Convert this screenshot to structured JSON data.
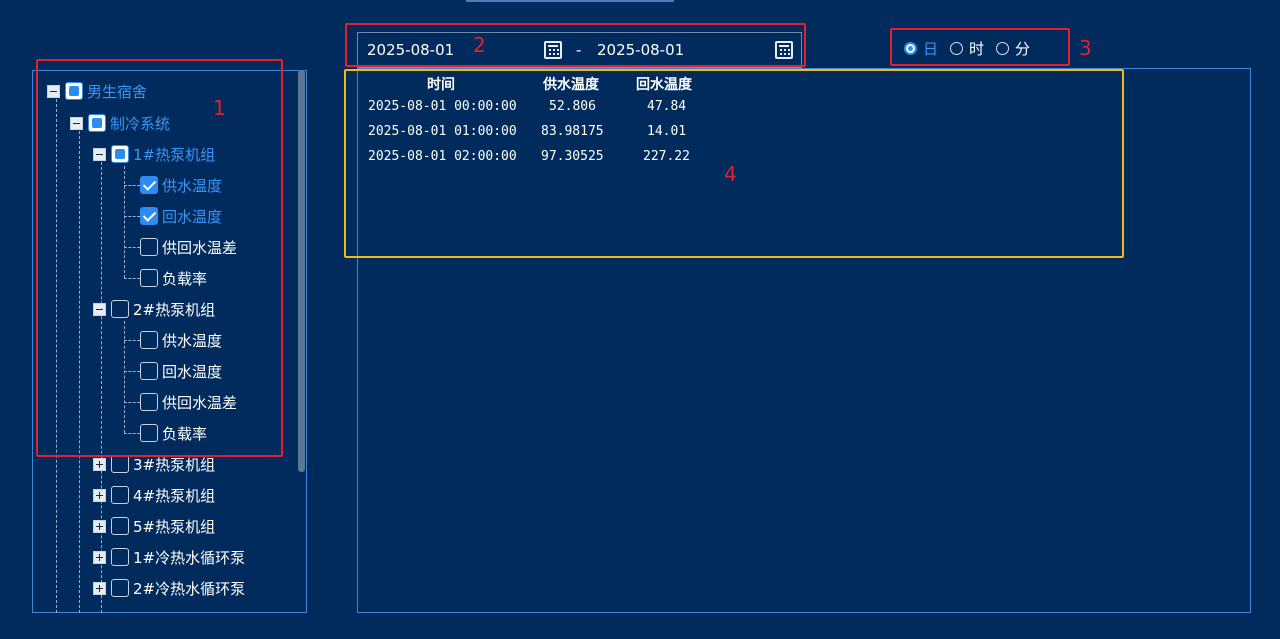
{
  "tree": {
    "items": [
      {
        "label": "男生宿舍",
        "state": "indeterminate",
        "expander": "minus"
      },
      {
        "label": "制冷系统",
        "state": "indeterminate",
        "expander": "minus"
      },
      {
        "label": "1#热泵机组",
        "state": "indeterminate",
        "expander": "minus"
      },
      {
        "label": "供水温度",
        "state": "checked"
      },
      {
        "label": "回水温度",
        "state": "checked"
      },
      {
        "label": "供回水温差",
        "state": "unchecked"
      },
      {
        "label": "负载率",
        "state": "unchecked"
      },
      {
        "label": "2#热泵机组",
        "state": "unchecked",
        "expander": "minus"
      },
      {
        "label": "供水温度",
        "state": "unchecked"
      },
      {
        "label": "回水温度",
        "state": "unchecked"
      },
      {
        "label": "供回水温差",
        "state": "unchecked"
      },
      {
        "label": "负载率",
        "state": "unchecked"
      },
      {
        "label": "3#热泵机组",
        "state": "unchecked",
        "expander": "plus"
      },
      {
        "label": "4#热泵机组",
        "state": "unchecked",
        "expander": "plus"
      },
      {
        "label": "5#热泵机组",
        "state": "unchecked",
        "expander": "plus"
      },
      {
        "label": "1#冷热水循环泵",
        "state": "unchecked",
        "expander": "plus"
      },
      {
        "label": "2#冷热水循环泵",
        "state": "unchecked",
        "expander": "plus"
      }
    ]
  },
  "date_range": {
    "start": "2025-08-01",
    "separator": "-",
    "end": "2025-08-01"
  },
  "granularity": {
    "options": [
      "日",
      "时",
      "分"
    ],
    "selected": "日"
  },
  "table": {
    "headers": [
      "时间",
      "供水温度",
      "回水温度"
    ],
    "rows": [
      [
        "2025-08-01 00:00:00",
        "52.806",
        "47.84"
      ],
      [
        "2025-08-01 01:00:00",
        "83.98175",
        "14.01"
      ],
      [
        "2025-08-01 02:00:00",
        "97.30525",
        "227.22"
      ]
    ]
  },
  "annotations": [
    "1",
    "2",
    "3",
    "4"
  ],
  "colors": {
    "background": "#012b5c",
    "accent": "#2d8cf0",
    "annotation_red": "#e3202b",
    "annotation_yellow": "#f0b91a"
  }
}
